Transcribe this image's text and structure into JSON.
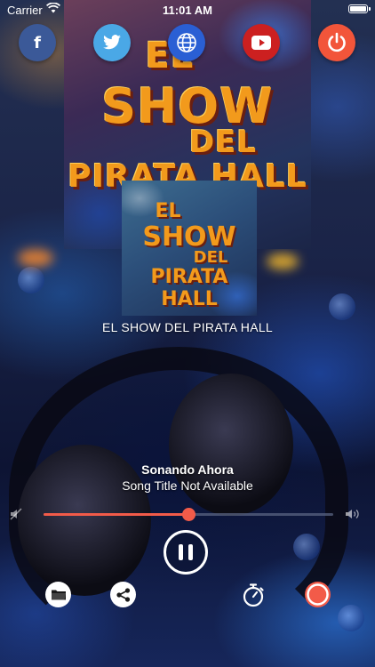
{
  "status_bar": {
    "carrier": "Carrier",
    "time": "11:01 AM"
  },
  "poster": {
    "line1": "EL",
    "line2": "SHOW",
    "line3": "DEL",
    "line4": "PIRATA HALL"
  },
  "social": [
    {
      "icon": "facebook-icon",
      "color": "#3b5998"
    },
    {
      "icon": "twitter-icon",
      "color": "#4aa8e6"
    },
    {
      "icon": "globe-icon",
      "color": "#2a5fd4"
    },
    {
      "icon": "youtube-icon",
      "color": "#cc2020"
    },
    {
      "icon": "power-icon",
      "color": "#f2553a"
    }
  ],
  "player": {
    "station_name": "EL SHOW DEL PIRATA HALL",
    "now_playing_label": "Sonando Ahora",
    "song_title": "Song Title Not Available",
    "volume_percent": 50,
    "state": "playing"
  },
  "actions": [
    {
      "icon": "folder-icon"
    },
    {
      "icon": "share-icon"
    },
    {
      "icon": "timer-icon"
    },
    {
      "icon": "record-icon"
    }
  ],
  "colors": {
    "accent": "#f25b49",
    "logo_orange": "#f29a1c"
  }
}
